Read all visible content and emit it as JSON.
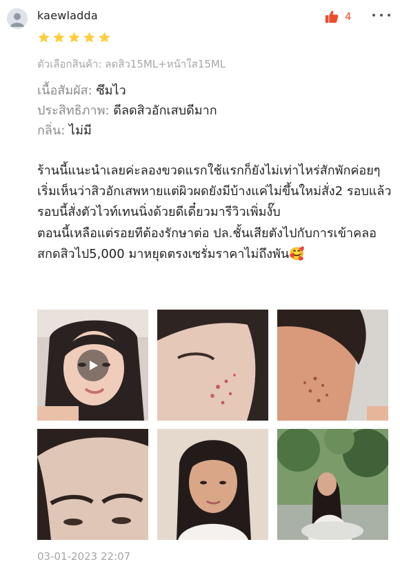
{
  "review": {
    "username": "kaewladda",
    "like_count": "4",
    "rating": 5,
    "variation_label": "ตัวเลือกสินค้า: ลดสิว15ML+หน้าใส15ML",
    "attributes": [
      {
        "key": "เนื้อสัมผัส:",
        "value": "ซึมไว"
      },
      {
        "key": "ประสิทธิภาพ:",
        "value": "ดีลดสิวอักเสบดีมาก"
      },
      {
        "key": "กลิ่น:",
        "value": "ไม่มี"
      }
    ],
    "text_lines": [
      "ร้านนี้แนะนำเลยค่ะลองขวดแรกใช้แรกก็ยังไม่เท่าไหร่สักพักค่อยๆเริ่มเห็นว่าสิวอักเสพหายแต่ผิวผดยังมีบ้างแค่ไม่ขึ้นใหม่สั่ง2 รอบแล้วรอบนี้สั่งตัวไวท์เทนนิ่งด้วยดีเดี๋ยวมารีวิวเพิ่มงั๊บ",
      "ตอนนี้เหลือแต่รอยทีต้องรักษาต่อ ปล.ชั้นเสียตังไปกับการเข้าคลอสกดสิวไป5,000 มาหยุดตรงเซรั่มราคาไม่ถึงพัน🥰"
    ],
    "media": [
      {
        "type": "video",
        "label": "video-thumbnail"
      },
      {
        "type": "photo",
        "label": "photo-cheek-closeup"
      },
      {
        "type": "photo",
        "label": "photo-cheek-side"
      },
      {
        "type": "photo",
        "label": "photo-forehead"
      },
      {
        "type": "photo",
        "label": "photo-selfie"
      },
      {
        "type": "photo",
        "label": "photo-outdoor"
      }
    ],
    "timestamp": "03-01-2023 22:07"
  },
  "colors": {
    "accent": "#ee4d2d",
    "star": "#ffce3d",
    "muted": "#a6a6a6"
  },
  "icons": {
    "avatar": "user-avatar-icon",
    "like": "thumbs-up-icon",
    "more": "more-dots-icon",
    "play": "play-icon",
    "star": "star-icon"
  }
}
